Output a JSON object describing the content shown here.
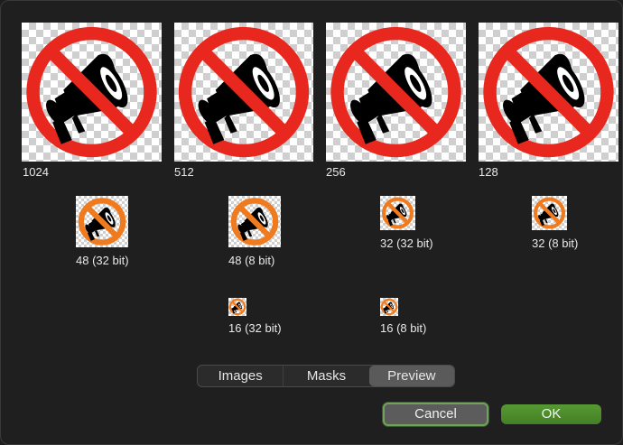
{
  "previews": [
    {
      "label": "1024"
    },
    {
      "label": "512"
    },
    {
      "label": "256"
    },
    {
      "label": "128"
    },
    {
      "label": "48 (32 bit)"
    },
    {
      "label": "48 (8 bit)"
    },
    {
      "label": "32 (32 bit)"
    },
    {
      "label": "32 (8 bit)"
    },
    {
      "label": "16 (32 bit)"
    },
    {
      "label": "16 (8 bit)"
    }
  ],
  "tabs": {
    "images": "Images",
    "masks": "Masks",
    "preview": "Preview",
    "selected": "Preview"
  },
  "buttons": {
    "cancel": "Cancel",
    "ok": "OK"
  },
  "colors": {
    "prohibition_red": "#e8281e",
    "prohibition_orange": "#f07a1e",
    "accent_green": "#4a8a2a"
  },
  "icon": "no-megaphone-icon"
}
